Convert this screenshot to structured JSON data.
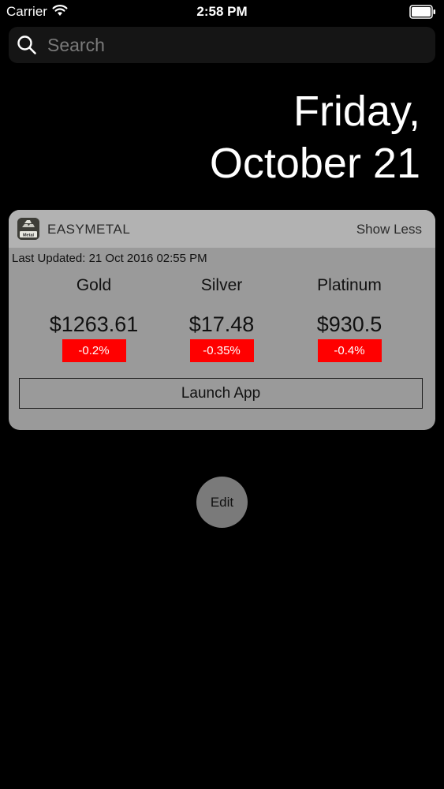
{
  "status_bar": {
    "carrier": "Carrier",
    "time": "2:58 PM",
    "wifi_icon": "wifi-icon",
    "battery_icon": "battery-icon"
  },
  "search": {
    "placeholder": "Search",
    "icon": "search-icon"
  },
  "date": {
    "weekday": "Friday,",
    "month_day": "October 21"
  },
  "widget": {
    "app_name": "EASYMETAL",
    "app_icon_label": "Metal",
    "show_less": "Show Less",
    "last_updated": "Last Updated: 21 Oct 2016 02:55 PM",
    "metals": [
      {
        "name": "Gold",
        "price": "$1263.61",
        "change": "-0.2%"
      },
      {
        "name": "Silver",
        "price": "$17.48",
        "change": "-0.35%"
      },
      {
        "name": "Platinum",
        "price": "$930.5",
        "change": "-0.4%"
      }
    ],
    "launch_label": "Launch App",
    "change_color": "#ff0000"
  },
  "edit_label": "Edit"
}
